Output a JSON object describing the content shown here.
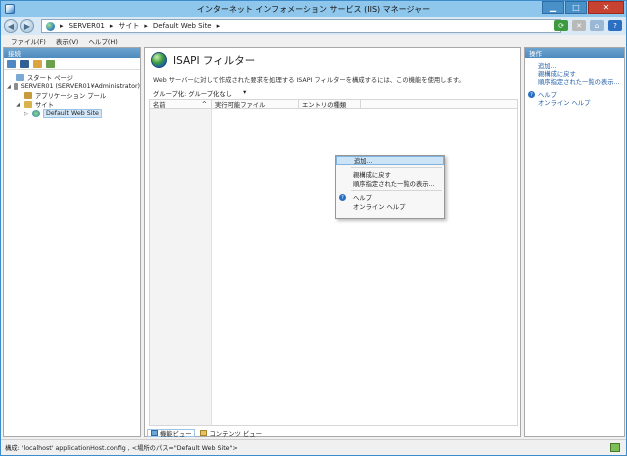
{
  "window": {
    "title": "インターネット インフォメーション サービス (IIS) マネージャー"
  },
  "address": {
    "crumbs": [
      "SERVER01",
      "サイト",
      "Default Web Site"
    ]
  },
  "menu": {
    "items": [
      "ファイル(F)",
      "表示(V)",
      "ヘルプ(H)"
    ]
  },
  "connections": {
    "header": "接続",
    "tree": [
      {
        "label": "スタート ページ",
        "indent": 0,
        "twisty": ""
      },
      {
        "label": "SERVER01 (SERVER01¥Administrator)",
        "indent": 0,
        "twisty": "◢"
      },
      {
        "label": "アプリケーション プール",
        "indent": 1,
        "twisty": ""
      },
      {
        "label": "サイト",
        "indent": 1,
        "twisty": "◢"
      },
      {
        "label": "Default Web Site",
        "indent": 2,
        "twisty": "▷"
      }
    ]
  },
  "center": {
    "title": "ISAPI フィルター",
    "description": "Web サーバーに対して作成された要求を処理する ISAPI フィルターを構成するには、この機能を使用します。",
    "group_label": "グループ化:",
    "group_value": "グループ化なし",
    "columns": [
      "名前",
      "実行可能ファイル",
      "エントリの種類"
    ],
    "view_tabs": [
      "機能ビュー",
      "コンテンツ ビュー"
    ]
  },
  "context_menu": {
    "items": [
      "追加...",
      "親構成に戻す",
      "順序指定された一覧の表示...",
      "ヘルプ",
      "オンライン ヘルプ"
    ]
  },
  "actions": {
    "header": "操作",
    "items": [
      "追加...",
      "親構成に戻す",
      "順序指定された一覧の表示..."
    ],
    "help": "ヘルプ",
    "online_help": "オンライン ヘルプ"
  },
  "status": {
    "text": "構成: 'localhost' applicationHost.config , <場所のパス=\"Default Web Site\">"
  }
}
